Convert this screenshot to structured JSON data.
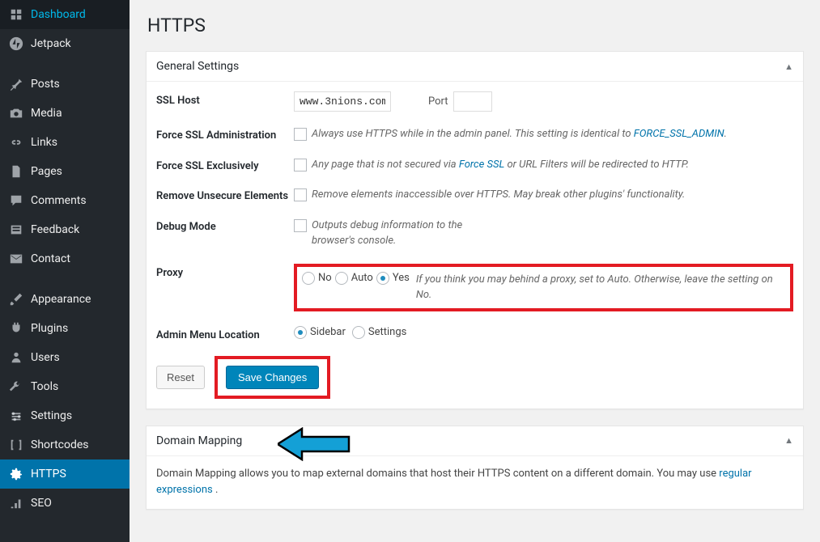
{
  "sidebar": {
    "items": [
      {
        "label": "Dashboard",
        "icon": "dashboard"
      },
      {
        "label": "Jetpack",
        "icon": "jetpack"
      },
      {
        "label": "Posts",
        "icon": "pin"
      },
      {
        "label": "Media",
        "icon": "media"
      },
      {
        "label": "Links",
        "icon": "link"
      },
      {
        "label": "Pages",
        "icon": "pages"
      },
      {
        "label": "Comments",
        "icon": "comment"
      },
      {
        "label": "Feedback",
        "icon": "feedback"
      },
      {
        "label": "Contact",
        "icon": "mail"
      },
      {
        "label": "Appearance",
        "icon": "brush"
      },
      {
        "label": "Plugins",
        "icon": "plugin"
      },
      {
        "label": "Users",
        "icon": "users"
      },
      {
        "label": "Tools",
        "icon": "tools"
      },
      {
        "label": "Settings",
        "icon": "settings"
      },
      {
        "label": "Shortcodes",
        "icon": "shortcode"
      },
      {
        "label": "HTTPS",
        "icon": "gear",
        "active": true
      },
      {
        "label": "SEO",
        "icon": "seo"
      }
    ]
  },
  "page": {
    "title": "HTTPS"
  },
  "settings": {
    "general_heading": "General Settings",
    "ssl_host_label": "SSL Host",
    "ssl_host_value": "www.3nions.com",
    "port_label": "Port",
    "port_value": "",
    "force_admin_label": "Force SSL Administration",
    "force_admin_desc_pre": "Always use HTTPS while in the admin panel. This setting is identical to ",
    "force_admin_link": "FORCE_SSL_ADMIN",
    "force_admin_desc_post": ".",
    "force_excl_label": "Force SSL Exclusively",
    "force_excl_desc_pre": "Any page that is not secured via ",
    "force_excl_link": "Force SSL",
    "force_excl_desc_post": " or URL Filters will be redirected to HTTP.",
    "remove_label": "Remove Unsecure Elements",
    "remove_desc": "Remove elements inaccessible over HTTPS. May break other plugins' functionality.",
    "debug_label": "Debug Mode",
    "debug_desc": "Outputs debug information to the browser's console.",
    "proxy_label": "Proxy",
    "proxy_options": {
      "no": "No",
      "auto": "Auto",
      "yes": "Yes"
    },
    "proxy_desc": "If you think you may behind a proxy, set to Auto. Otherwise, leave the setting on No.",
    "adminloc_label": "Admin Menu Location",
    "adminloc_options": {
      "sidebar": "Sidebar",
      "settings": "Settings"
    }
  },
  "actions": {
    "reset": "Reset",
    "save": "Save Changes"
  },
  "mapping": {
    "heading": "Domain Mapping",
    "desc_pre": "Domain Mapping allows you to map external domains that host their HTTPS content on a different domain. You may use ",
    "desc_link": "regular expressions",
    "desc_post": " ."
  }
}
